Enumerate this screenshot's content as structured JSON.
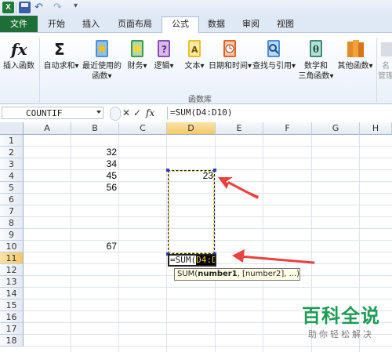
{
  "quick_access": {
    "app_icon": "X",
    "undo_glyph": "↶",
    "redo_glyph": "↷",
    "menu_glyph": "▾"
  },
  "tabs": [
    {
      "label": "文件"
    },
    {
      "label": "开始"
    },
    {
      "label": "插入"
    },
    {
      "label": "页面布局"
    },
    {
      "label": "公式"
    },
    {
      "label": "数据"
    },
    {
      "label": "审阅"
    },
    {
      "label": "视图"
    }
  ],
  "active_tab": "公式",
  "ribbon": {
    "insert_function": "插入函数",
    "autosum": "自动求和",
    "recent_line1": "最近使用的",
    "recent_line2": "函数",
    "financial": "财务",
    "logical": "逻辑",
    "text": "文本",
    "datetime": "日期和时间",
    "lookup": "查找与引用",
    "math_line1": "数学和",
    "math_line2": "三角函数",
    "other": "其他函数",
    "name_mgr_line1": "名",
    "name_mgr_line2": "管理",
    "group_label": "函数库",
    "dropdown": "▾"
  },
  "formula_bar": {
    "name_box": "COUNTIF",
    "cancel": "✕",
    "enter": "✓",
    "fx": "fx",
    "formula": "=SUM(D4:D10)"
  },
  "columns": [
    "A",
    "B",
    "C",
    "D",
    "E",
    "F",
    "G",
    "H"
  ],
  "rows": [
    "1",
    "2",
    "3",
    "4",
    "5",
    "6",
    "7",
    "8",
    "9",
    "10",
    "11",
    "12",
    "13",
    "14",
    "15",
    "16",
    "17",
    "18"
  ],
  "cells": {
    "B2": "32",
    "B3": "34",
    "B4": "45",
    "B5": "56",
    "B10": "67",
    "D4": "23"
  },
  "edit_cell": {
    "prefix": "=SUM(",
    "highlighted": "D4:D10"
  },
  "tooltip": {
    "fn": "SUM(",
    "arg1": "number1",
    "rest": ", [number2], ...)"
  },
  "watermark": {
    "main": "百科全说",
    "sub": "助你轻松解决"
  },
  "colors": {
    "file_tab": "#1d6f37",
    "arrow": "#e8423f",
    "watermark": "#1e9b54"
  }
}
